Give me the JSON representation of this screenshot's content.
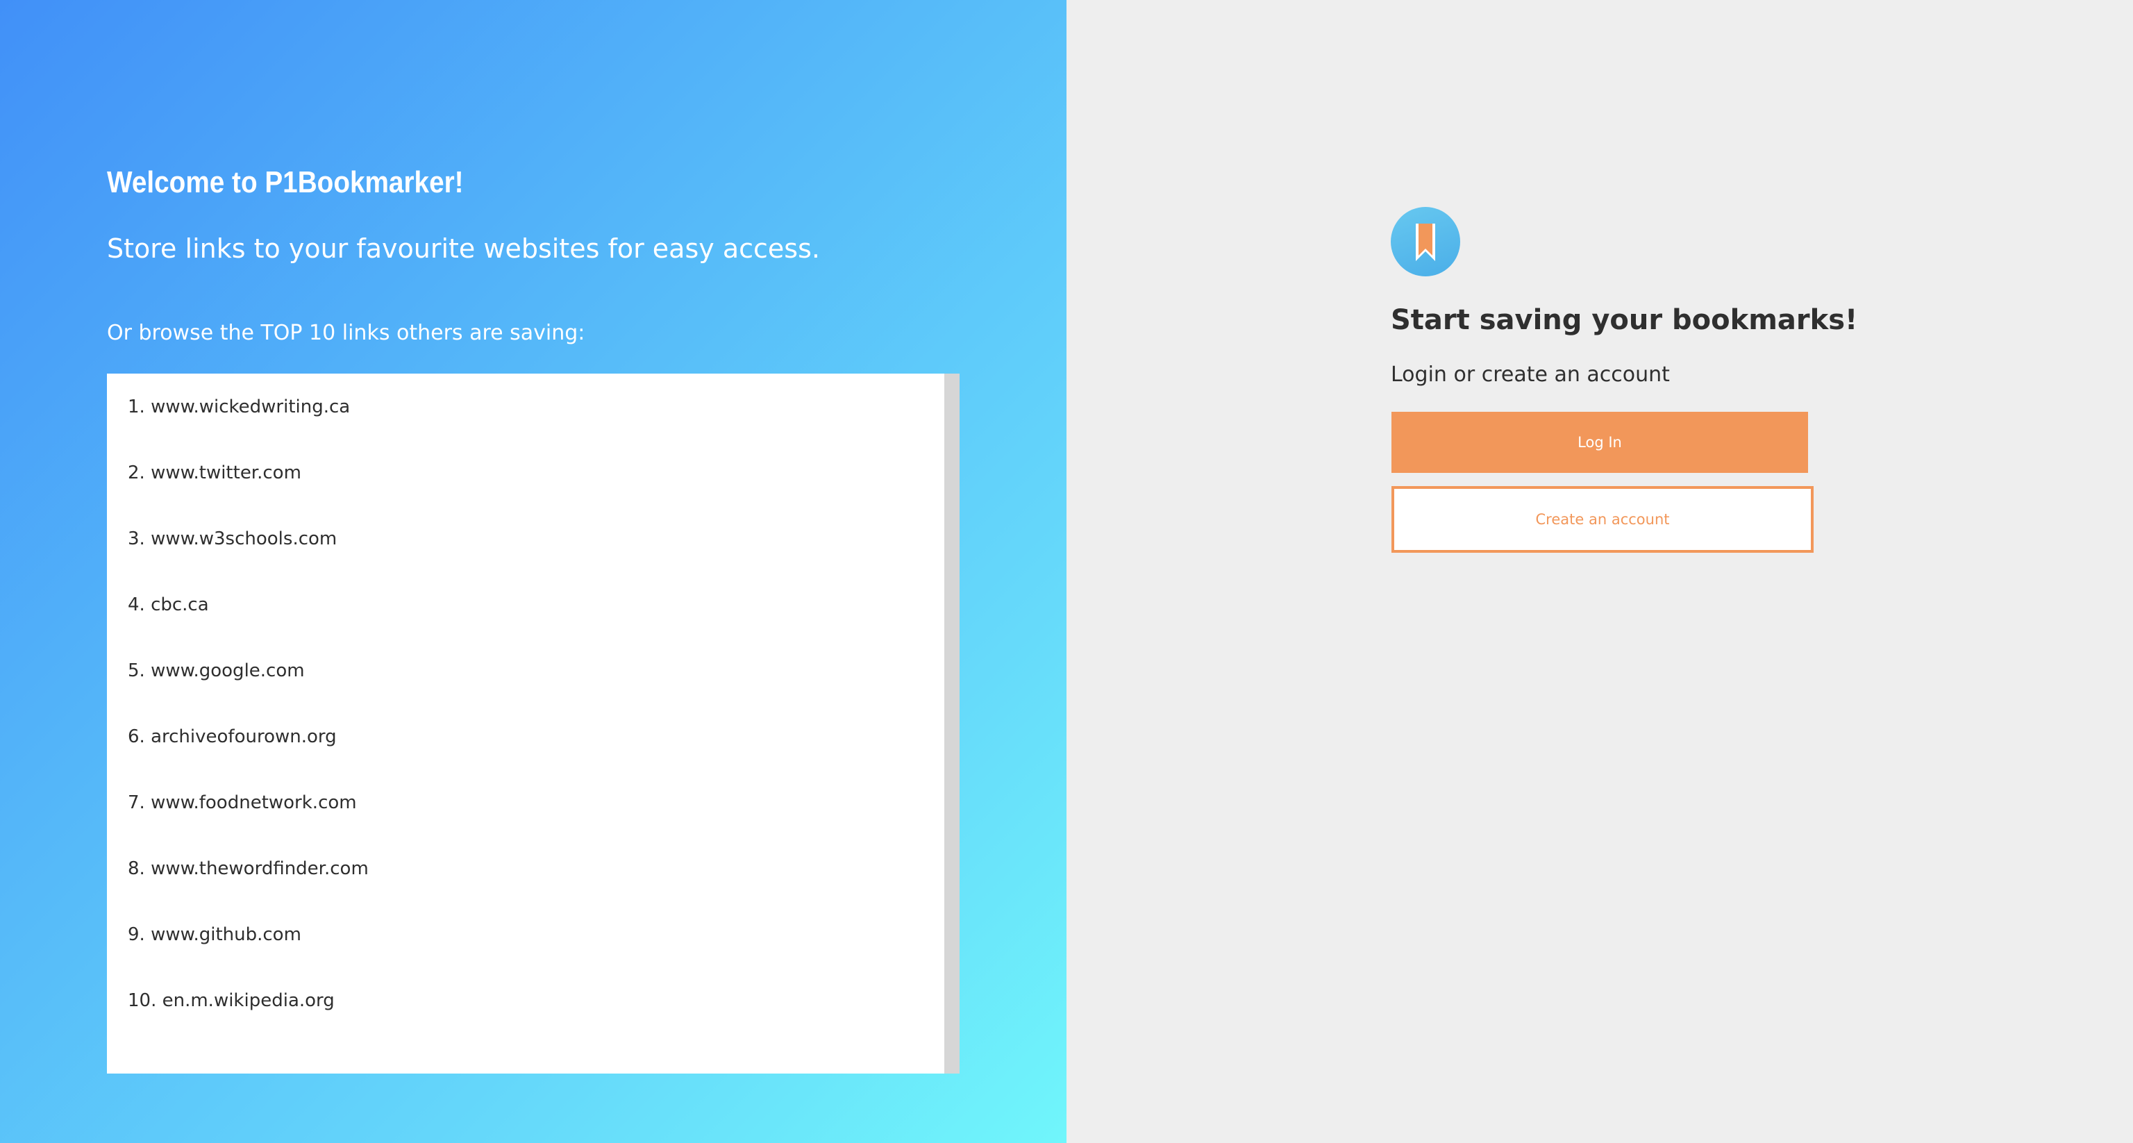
{
  "welcome": {
    "title": "Welcome to P1Bookmarker!",
    "subtitle": "Store links to your favourite websites for easy access.",
    "browse_label": "Or browse the TOP 10 links others are saving:"
  },
  "top_links": [
    "1. www.wickedwriting.ca",
    "2. www.twitter.com",
    "3. www.w3schools.com",
    "4. cbc.ca",
    "5. www.google.com",
    "6. archiveofourown.org",
    "7. www.foodnetwork.com",
    "8. www.thewordfinder.com",
    "9. www.github.com",
    "10. en.m.wikipedia.org"
  ],
  "auth": {
    "logo_icon": "bookmark-icon",
    "heading": "Start saving your bookmarks!",
    "prompt": "Login or create an account",
    "login_label": "Log In",
    "create_label": "Create an account"
  },
  "colors": {
    "accent": "#f2975a",
    "gradient_start": "#4190f8",
    "gradient_end": "#70f6fb",
    "right_background": "#eeeeee"
  }
}
